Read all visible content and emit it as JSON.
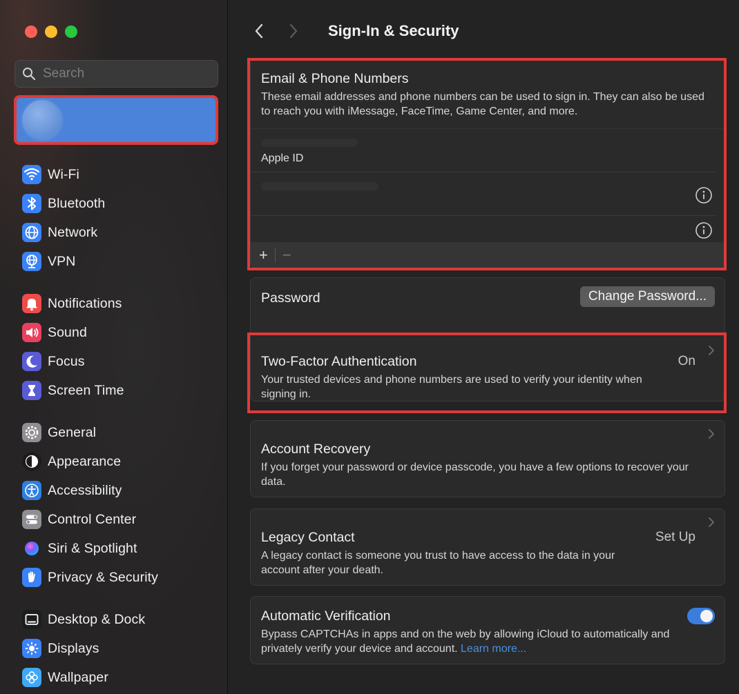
{
  "window": {
    "title": "Sign-In & Security"
  },
  "sidebar": {
    "search_placeholder": "Search",
    "groups": [
      [
        {
          "label": "Wi-Fi",
          "icon": "wifi-icon",
          "color": "#3b82f6"
        },
        {
          "label": "Bluetooth",
          "icon": "bluetooth-icon",
          "color": "#3b82f6"
        },
        {
          "label": "Network",
          "icon": "globe-icon",
          "color": "#3b82f6"
        },
        {
          "label": "VPN",
          "icon": "vpn-globe-icon",
          "color": "#3b82f6"
        }
      ],
      [
        {
          "label": "Notifications",
          "icon": "bell-icon",
          "color": "#ef4b4b"
        },
        {
          "label": "Sound",
          "icon": "speaker-icon",
          "color": "#e8405f"
        },
        {
          "label": "Focus",
          "icon": "moon-icon",
          "color": "#5b5bd6"
        },
        {
          "label": "Screen Time",
          "icon": "hourglass-icon",
          "color": "#5b5bd6"
        }
      ],
      [
        {
          "label": "General",
          "icon": "gear-icon",
          "color": "#8e8e93"
        },
        {
          "label": "Appearance",
          "icon": "appearance-icon",
          "color": "#1c1c1e"
        },
        {
          "label": "Accessibility",
          "icon": "accessibility-icon",
          "color": "#2f7fe0"
        },
        {
          "label": "Control Center",
          "icon": "toggles-icon",
          "color": "#8e8e93"
        },
        {
          "label": "Siri & Spotlight",
          "icon": "siri-icon",
          "color": "#7a4fd6"
        },
        {
          "label": "Privacy & Security",
          "icon": "hand-icon",
          "color": "#3b82f6"
        }
      ],
      [
        {
          "label": "Desktop & Dock",
          "icon": "dock-icon",
          "color": "#1c1c1e"
        },
        {
          "label": "Displays",
          "icon": "sun-icon",
          "color": "#3b82f6"
        },
        {
          "label": "Wallpaper",
          "icon": "flower-icon",
          "color": "#3fa9f5"
        }
      ]
    ]
  },
  "main": {
    "email": {
      "title": "Email & Phone Numbers",
      "description": "These email addresses and phone numbers can be used to sign in. They can also be used to reach you with iMessage, FaceTime, Game Center, and more.",
      "apple_id_label": "Apple ID",
      "add_label": "+",
      "remove_label": "−"
    },
    "password": {
      "title": "Password",
      "button": "Change Password..."
    },
    "two_factor": {
      "title": "Two-Factor Authentication",
      "description": "Your trusted devices and phone numbers are used to verify your identity when signing in.",
      "status": "On"
    },
    "recovery": {
      "title": "Account Recovery",
      "description": "If you forget your password or device passcode, you have a few options to recover your data."
    },
    "legacy": {
      "title": "Legacy Contact",
      "description": "A legacy contact is someone you trust to have access to the data in your account after your death.",
      "status": "Set Up"
    },
    "auto_verification": {
      "title": "Automatic Verification",
      "description": "Bypass CAPTCHAs in apps and on the web by allowing iCloud to automatically and privately verify your device and account. ",
      "link": "Learn more...",
      "enabled": true
    }
  },
  "colors": {
    "highlight": "#e03a3a",
    "accent": "#3b7ddd",
    "link": "#4a90e2"
  }
}
